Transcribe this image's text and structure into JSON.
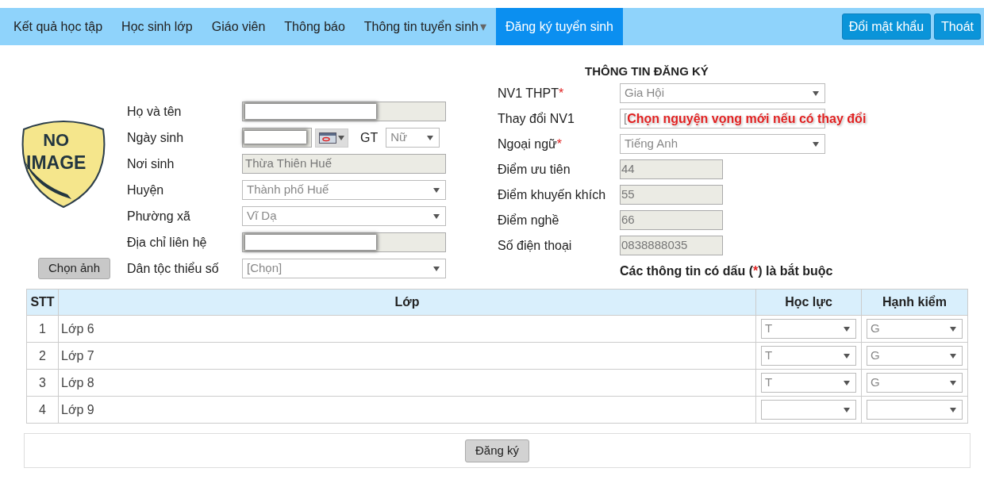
{
  "nav": {
    "items": [
      {
        "label": "Kết quả học tập",
        "selected": false
      },
      {
        "label": "Học sinh lớp",
        "selected": false
      },
      {
        "label": "Giáo viên",
        "selected": false
      },
      {
        "label": "Thông báo",
        "selected": false
      },
      {
        "label": "Thông tin tuyển sinh",
        "selected": false,
        "caret": "▾"
      },
      {
        "label": "Đăng ký tuyển sinh",
        "selected": true
      }
    ],
    "buttons": [
      "Đổi mật khẩu",
      "Thoát"
    ]
  },
  "photo": {
    "lines": [
      "NO",
      "IMAGE"
    ],
    "button": "Chọn ảnh"
  },
  "personal": [
    {
      "kind": "text",
      "label": "Họ và tên",
      "disabled": true,
      "redacted": true
    },
    {
      "kind": "date",
      "label": "Ngày sinh",
      "redacted": true,
      "gender_label": "GT",
      "gender_value": "Nữ"
    },
    {
      "kind": "text",
      "label": "Nơi sinh",
      "disabled": true,
      "value": "Thừa Thiên Huế"
    },
    {
      "kind": "select",
      "label": "Huyện",
      "value": "Thành phố Huế"
    },
    {
      "kind": "select",
      "label": "Phường xã",
      "value": "Vĩ Dạ"
    },
    {
      "kind": "text",
      "label": "Địa chỉ liên hệ",
      "disabled": true,
      "redacted": true
    },
    {
      "kind": "select",
      "label": "Dân tộc thiểu số",
      "value": "[Chọn]"
    }
  ],
  "registration": {
    "title": "THÔNG TIN ĐĂNG KÝ",
    "fields": [
      {
        "kind": "select",
        "label": "NV1 THPT",
        "mark": "*",
        "value": "Gia Hội"
      },
      {
        "kind": "select",
        "label": "Thay đổi NV1",
        "value": "[",
        "annotation": "Chọn nguyện vọng mới nếu có thay đổi"
      },
      {
        "kind": "select",
        "label": "Ngoại ngữ",
        "mark": "*",
        "value": "Tiếng Anh"
      },
      {
        "kind": "short",
        "label": "Điểm ưu tiên",
        "value": "44"
      },
      {
        "kind": "short",
        "label": "Điểm khuyến khích",
        "value": "55"
      },
      {
        "kind": "short",
        "label": "Điểm nghề",
        "value": "66"
      },
      {
        "kind": "short",
        "label": "Số điện thoại",
        "value": "0838888035"
      }
    ],
    "note": [
      "Các thông tin có dấu (",
      "*",
      ") là bắt buộc"
    ]
  },
  "table": {
    "columns": [
      "STT",
      "Lớp",
      "Học lực",
      "Hạnh kiểm"
    ],
    "rows": [
      {
        "stt": "1",
        "lop": "Lớp 6",
        "hoc_luc": "T",
        "hanh_kiem": "G"
      },
      {
        "stt": "2",
        "lop": "Lớp 7",
        "hoc_luc": "T",
        "hanh_kiem": "G"
      },
      {
        "stt": "3",
        "lop": "Lớp 8",
        "hoc_luc": "T",
        "hanh_kiem": "G"
      },
      {
        "stt": "4",
        "lop": "Lớp 9"
      }
    ]
  },
  "submit": "Đăng ký"
}
